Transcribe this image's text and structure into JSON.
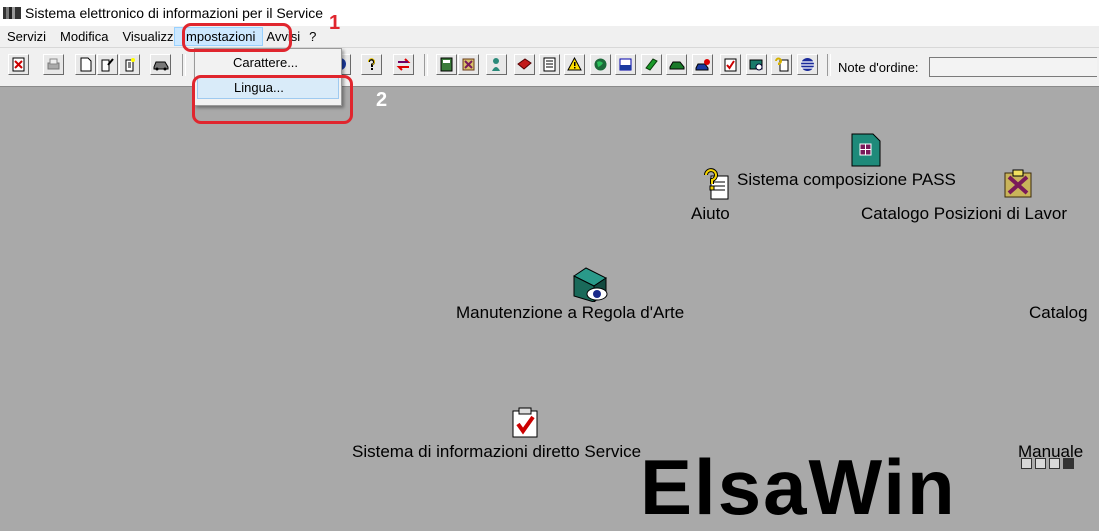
{
  "window": {
    "title": "Sistema elettronico di informazioni per il Service"
  },
  "menubar": {
    "items": [
      "Servizi",
      "Modifica",
      "Visualizza",
      "Impostazioni",
      "Avvisi",
      "?"
    ]
  },
  "dropdown": {
    "items": [
      "Carattere...",
      "Lingua..."
    ]
  },
  "toolbar": {
    "note_label": "Note d'ordine:",
    "note_value": ""
  },
  "annotations": {
    "step1": "1",
    "step2": "2",
    "color": "#e0262e"
  },
  "desktop": {
    "items": [
      {
        "label": "Sistema composizione PASS",
        "icon": "pass-composer-icon"
      },
      {
        "label": "Aiuto",
        "icon": "help-icon"
      },
      {
        "label": "Catalogo Posizioni di Lavor",
        "icon": "catalog-positions-icon"
      },
      {
        "label": "Manutenzione a Regola d'Arte",
        "icon": "maintenance-icon"
      },
      {
        "label": "Catalog",
        "icon": ""
      },
      {
        "label": "Sistema di informazioni diretto Service",
        "icon": "checklist-icon"
      },
      {
        "label": "Manuale",
        "icon": ""
      }
    ],
    "brand_text": "ElsaWin"
  },
  "colors": {
    "desktop_bg": "#a9a9a9",
    "menu_highlight": "#cce8ff"
  }
}
